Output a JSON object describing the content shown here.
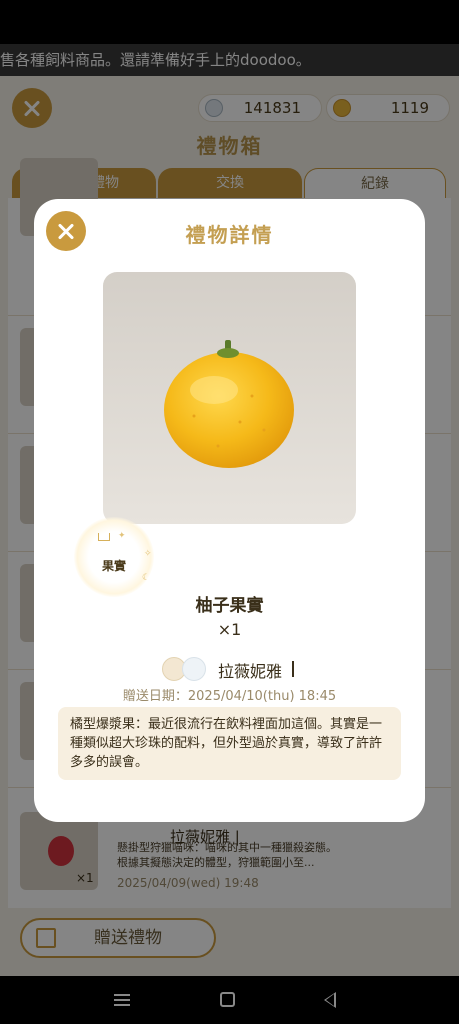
{
  "marquee_text": "售各種飼料商品。還請準備好手上的doodoo。",
  "currency": {
    "diamond": "141831",
    "coin": "1119"
  },
  "background": {
    "title": "禮物箱",
    "tabs": [
      "收到的禮物",
      "交換",
      "紀錄"
    ],
    "row": {
      "sender": "拉薇妮雅 |",
      "description": "懸掛型狩獵喵咪：喵咪的其中一種獵殺姿態。根據其擬態決定的體型，狩獵範圍小至...",
      "date": "2025/04/09(wed) 19:48",
      "qty": "×1"
    },
    "send_gift_label": "贈送禮物"
  },
  "modal": {
    "title": "禮物詳情",
    "badge_label": "果實",
    "item_name": "柚子果實",
    "quantity": "×1",
    "sender_name": "拉薇妮雅",
    "send_date": "贈送日期：2025/04/10(thu) 18:45",
    "description": "橘型爆漿果：最近很流行在飲料裡面加這個。其實是一種類似超大珍珠的配料，但外型過於真實，導致了許許多多的誤會。"
  },
  "colors": {
    "accent": "#c99a3e",
    "title_gold": "#c49f52",
    "desc_bg": "#f7efe0"
  }
}
